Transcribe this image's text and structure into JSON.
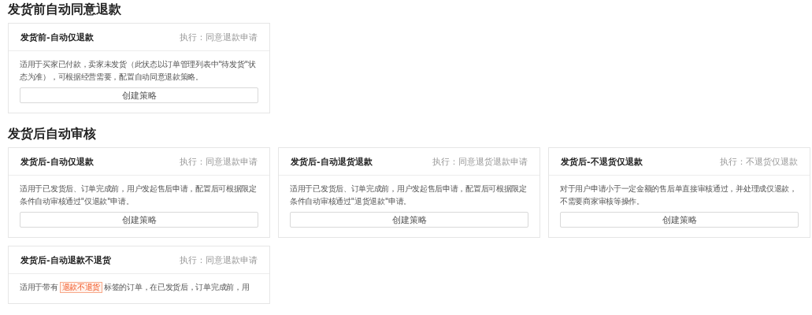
{
  "sections": [
    {
      "title": "发货前自动同意退款",
      "cards": [
        {
          "title": "发货前-自动仅退款",
          "action": "执行：同意退款申请",
          "description": [
            {
              "kind": "text",
              "text": "适用于买家已付款，卖家未发货（此状态以订单管理列表中\"待发货\"状态为准），可根据经营需要，配置自动同意退款策略。"
            }
          ],
          "button": "创建策略"
        }
      ]
    },
    {
      "title": "发货后自动审核",
      "cards": [
        {
          "title": "发货后-自动仅退款",
          "action": "执行：同意退款申请",
          "description": [
            {
              "kind": "text",
              "text": "适用于已发货后、订单完成前，用户发起售后申请，配置后可根据限定条件自动审核通过\"仅退款\"申请。"
            }
          ],
          "button": "创建策略"
        },
        {
          "title": "发货后-自动退货退款",
          "action": "执行：同意退货退款申请",
          "description": [
            {
              "kind": "text",
              "text": "适用于已发货后、订单完成前，用户发起售后申请，配置后可根据限定条件自动审核通过\"退货退款\"申请。"
            }
          ],
          "button": "创建策略"
        },
        {
          "title": "发货后-不退货仅退款",
          "action": "执行：不退货仅退款",
          "description": [
            {
              "kind": "text",
              "text": "对于用户申请小于一定金额的售后单直接审核通过，并处理成仅退款，不需要商家审核等操作。"
            }
          ],
          "button": "创建策略"
        },
        {
          "title": "发货后-自动退款不退货",
          "action": "执行：同意退款申请",
          "description": [
            {
              "kind": "text",
              "text": "适用于带有"
            },
            {
              "kind": "tag",
              "text": "退款不退货"
            },
            {
              "kind": "text",
              "text": "标签的订单，在已发货后，订单完成前，用"
            }
          ]
        }
      ]
    }
  ]
}
